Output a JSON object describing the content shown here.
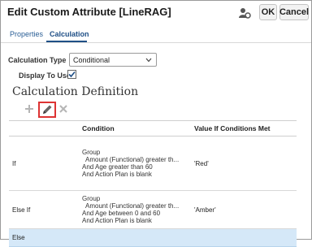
{
  "window": {
    "title": "Edit Custom Attribute [LineRAG]",
    "ok_label": "OK",
    "cancel_label": "Cancel"
  },
  "tabs": [
    {
      "label": "Properties"
    },
    {
      "label": "Calculation"
    }
  ],
  "form": {
    "calculation_type_label": "Calculation Type",
    "calculation_type_value": "Conditional",
    "display_to_user_label": "Display To User",
    "display_to_user_checked": true
  },
  "section_title": "Calculation Definition",
  "table": {
    "headers": [
      "",
      "Condition",
      "Value If Conditions Met"
    ],
    "rows": [
      {
        "type": "If",
        "condition": [
          "Group",
          "Amount (Functional) greater th...",
          "And Age greater than 60",
          "And Action Plan is blank"
        ],
        "value": "'Red'"
      },
      {
        "type": "Else If",
        "condition": [
          "Group",
          "Amount (Functional) greater th...",
          "And Age between 0 and 60",
          "And Action Plan is blank"
        ],
        "value": "'Amber'"
      },
      {
        "type": "Else",
        "condition": [],
        "value": ""
      }
    ]
  },
  "colors": {
    "accent": "#1f4f86",
    "selected_row": "#d5e8f8",
    "highlight_box": "#dd3333"
  }
}
